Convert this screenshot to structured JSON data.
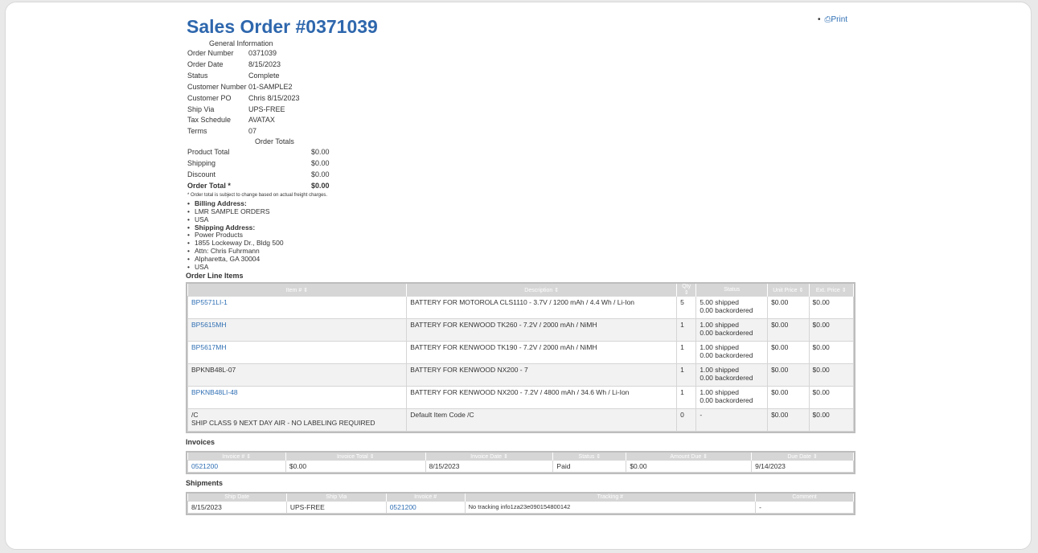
{
  "title": "Sales Order #0371039",
  "print_label": "Print",
  "general": {
    "caption": "General Information",
    "rows": [
      {
        "k": "Order Number",
        "v": "0371039"
      },
      {
        "k": "Order Date",
        "v": "8/15/2023"
      },
      {
        "k": "Status",
        "v": "Complete"
      },
      {
        "k": "Customer Number",
        "v": "01-SAMPLE2"
      },
      {
        "k": "Customer PO",
        "v": "Chris 8/15/2023"
      },
      {
        "k": "Ship Via",
        "v": "UPS-FREE"
      },
      {
        "k": "Tax Schedule",
        "v": "AVATAX"
      },
      {
        "k": "Terms",
        "v": "07"
      }
    ]
  },
  "totals": {
    "caption": "Order Totals",
    "rows": [
      {
        "k": "Product Total",
        "v": "$0.00"
      },
      {
        "k": "Shipping",
        "v": "$0.00"
      },
      {
        "k": "Discount",
        "v": "$0.00"
      },
      {
        "k": "Order Total *",
        "v": "$0.00"
      }
    ],
    "note": "* Order total is subject to change based on actual freight charges."
  },
  "addresses": {
    "billing_label": "Billing Address:",
    "billing": [
      "LMR SAMPLE ORDERS",
      "USA"
    ],
    "shipping_label": "Shipping Address:",
    "shipping": [
      "Power Products",
      "1855 Lockeway Dr., Bldg 500",
      "Attn: Chris Fuhrmann",
      "Alpharetta, GA 30004",
      "USA"
    ]
  },
  "line_items": {
    "title": "Order Line Items",
    "headers": [
      "Item # ⇕",
      "Description ⇕",
      "Qty ⇕",
      "Status",
      "Unit Price ⇕",
      "Ext. Price ⇕"
    ],
    "rows": [
      {
        "item": "BP5571LI-1",
        "link": true,
        "desc": "BATTERY FOR MOTOROLA CLS1110 - 3.7V / 1200 mAh / 4.4 Wh / Li-Ion",
        "qty": "5",
        "s1": "5.00 shipped",
        "s2": "0.00 backordered",
        "price": "$0.00",
        "ext": "$0.00"
      },
      {
        "item": "BP5615MH",
        "link": true,
        "desc": "BATTERY FOR KENWOOD TK260 - 7.2V / 2000 mAh / NiMH",
        "qty": "1",
        "s1": "1.00 shipped",
        "s2": "0.00 backordered",
        "price": "$0.00",
        "ext": "$0.00"
      },
      {
        "item": "BP5617MH",
        "link": true,
        "desc": "BATTERY FOR KENWOOD TK190 - 7.2V / 2000 mAh / NiMH",
        "qty": "1",
        "s1": "1.00 shipped",
        "s2": "0.00 backordered",
        "price": "$0.00",
        "ext": "$0.00"
      },
      {
        "item": "BPKNB48L-07",
        "link": false,
        "desc": "BATTERY FOR KENWOOD NX200 - 7",
        "qty": "1",
        "s1": "1.00 shipped",
        "s2": "0.00 backordered",
        "price": "$0.00",
        "ext": "$0.00"
      },
      {
        "item": "BPKNB48LI-48",
        "link": true,
        "desc": "BATTERY FOR KENWOOD NX200 - 7.2V / 4800 mAh / 34.6 Wh / Li-Ion",
        "qty": "1",
        "s1": "1.00 shipped",
        "s2": "0.00 backordered",
        "price": "$0.00",
        "ext": "$0.00"
      },
      {
        "item": "/C",
        "item2": "SHIP CLASS 9 NEXT DAY AIR - NO LABELING REQUIRED",
        "link": false,
        "desc": "Default Item Code /C",
        "qty": "0",
        "s1": "-",
        "s2": "",
        "price": "$0.00",
        "ext": "$0.00"
      }
    ]
  },
  "invoices": {
    "title": "Invoices",
    "headers": [
      "Invoice # ⇕",
      "Invoice Total ⇕",
      "Invoice Date ⇕",
      "Status ⇕",
      "Amount Due ⇕",
      "Due Date ⇕"
    ],
    "rows": [
      {
        "num": "0521200",
        "total": "$0.00",
        "date": "8/15/2023",
        "status": "Paid",
        "due": "$0.00",
        "due_date": "9/14/2023"
      }
    ]
  },
  "shipments": {
    "title": "Shipments",
    "headers": [
      "Ship Date",
      "Ship Via",
      "Invoice #",
      "Tracking #",
      "Comment"
    ],
    "rows": [
      {
        "date": "8/15/2023",
        "via": "UPS-FREE",
        "invoice": "0521200",
        "tracking": "No tracking info1za23e090154800142",
        "comment": "-"
      }
    ]
  }
}
